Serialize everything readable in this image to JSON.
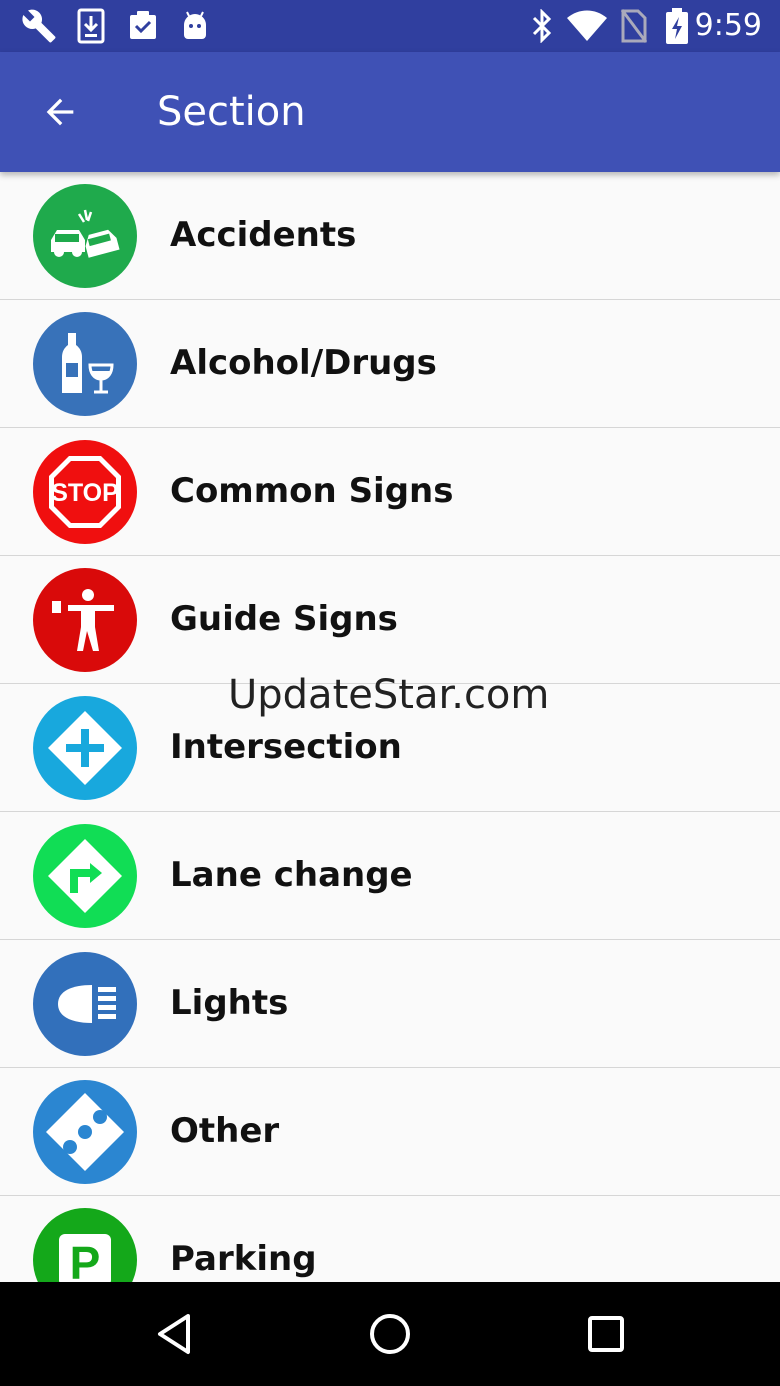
{
  "status_bar": {
    "time": "9:59",
    "left_icons": [
      "wrench-icon",
      "download-icon",
      "clipboard-check-icon",
      "android-icon"
    ],
    "right_icons": [
      "bluetooth-icon",
      "wifi-icon",
      "no-sim-icon",
      "battery-charging-icon"
    ]
  },
  "app_bar": {
    "title": "Section",
    "back_icon": "arrow-back-icon"
  },
  "sections": [
    {
      "label": "Accidents",
      "icon": "car-crash-icon",
      "color": "#1faa4c"
    },
    {
      "label": "Alcohol/Drugs",
      "icon": "bottle-glass-icon",
      "color": "#3872b9"
    },
    {
      "label": "Common Signs",
      "icon": "stop-sign-icon",
      "color": "#f00f0f",
      "icon_text": "STOP"
    },
    {
      "label": "Guide Signs",
      "icon": "traffic-officer-icon",
      "color": "#d90a0a"
    },
    {
      "label": "Intersection",
      "icon": "intersection-icon",
      "color": "#18a8dd"
    },
    {
      "label": "Lane change",
      "icon": "turn-right-icon",
      "color": "#11dd55"
    },
    {
      "label": "Lights",
      "icon": "headlight-icon",
      "color": "#3270bb"
    },
    {
      "label": "Other",
      "icon": "dots-diamond-icon",
      "color": "#2b86d1"
    },
    {
      "label": "Parking",
      "icon": "parking-icon",
      "color": "#14a81a",
      "icon_text": "P"
    }
  ],
  "watermark": "UpdateStar.com",
  "nav_bar": {
    "icons": [
      "back-triangle-icon",
      "home-circle-icon",
      "recents-square-icon"
    ]
  }
}
